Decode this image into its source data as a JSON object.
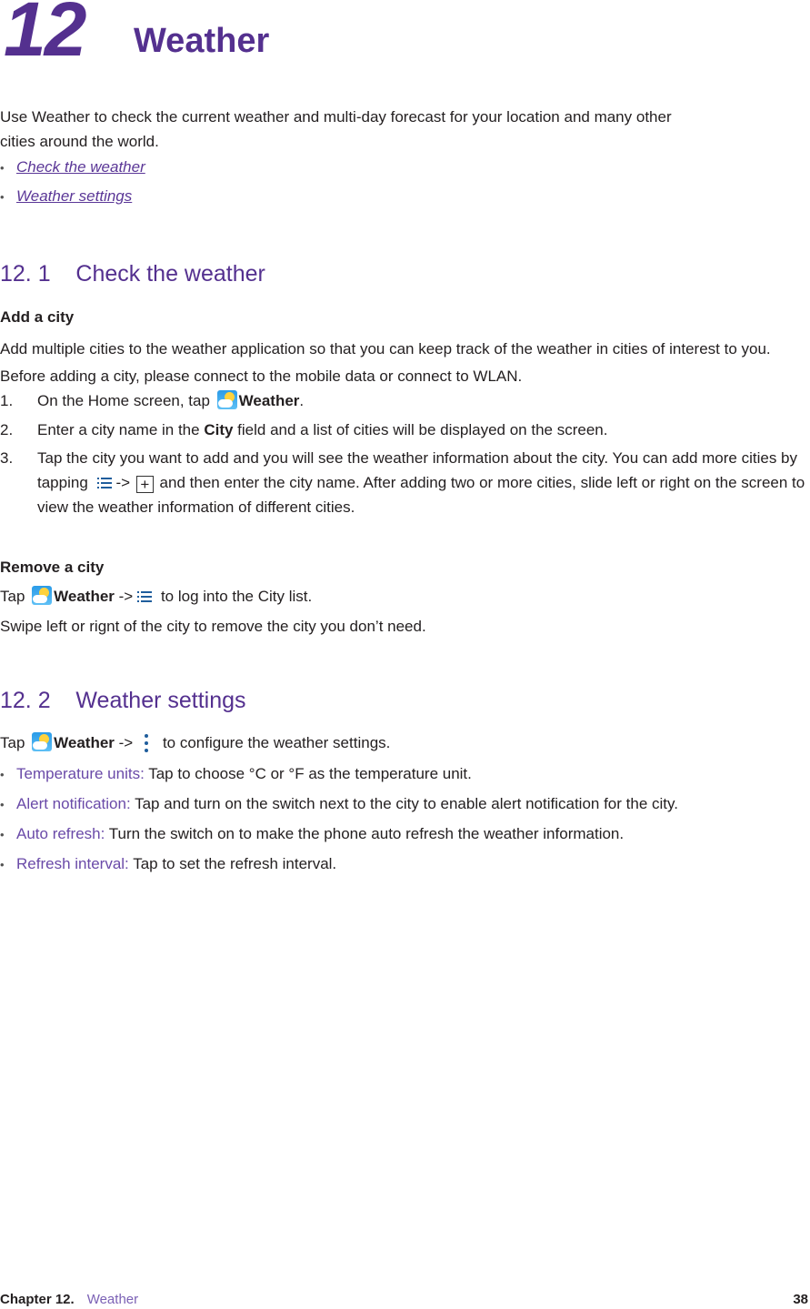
{
  "chapter": {
    "number": "12",
    "title": "Weather"
  },
  "intro": "Use Weather to check the current weather and multi-day forecast for your location and many other cities around the world.",
  "toc": [
    {
      "label": "Check the weather"
    },
    {
      "label": "Weather settings"
    }
  ],
  "section1": {
    "number": "12. 1",
    "title": "Check the weather",
    "add_city": {
      "heading": "Add a city",
      "description": "Add multiple cities to the weather application so that you can keep track of the weather in cities of interest to you. Before adding a city, please connect to the mobile data or connect to WLAN.",
      "steps": [
        {
          "num": "1.",
          "pre": "On the Home screen, tap ",
          "bold": "Weather",
          "post": "."
        },
        {
          "num": "2.",
          "pre": "Enter a city name in the ",
          "bold": "City",
          "post": " field and a list of cities will be displayed on the screen."
        },
        {
          "num": "3.",
          "pre": "Tap the city you want to add and you will see the weather information about the city. You can add more cities by tapping ",
          "arrow": "->",
          "post": " and then enter the city name. After adding two or more cities, slide left or right on the screen to view the weather information of different cities.",
          "plus": "+"
        }
      ]
    },
    "remove_city": {
      "heading": "Remove a city",
      "line1_pre": "Tap ",
      "line1_bold": "Weather",
      "line1_arrow": " ->",
      "line1_post": " to log into the City list.",
      "line2": "Swipe left or rignt of the city to remove the city you don’t need."
    }
  },
  "section2": {
    "number": "12. 2",
    "title": "Weather settings",
    "intro_pre": "Tap ",
    "intro_bold": "Weather",
    "intro_arrow": " ->",
    "intro_post": " to configure the weather settings.",
    "items": [
      {
        "term": "Temperature units:",
        "desc": " Tap to choose °C or °F as the temperature unit."
      },
      {
        "term": "Alert notification:",
        "desc": " Tap and turn on the switch next to the city to enable alert notification for the city."
      },
      {
        "term": "Auto refresh:",
        "desc": " Turn the switch on to make the phone auto refresh the weather information."
      },
      {
        "term": "Refresh interval:",
        "desc": " Tap to set the refresh interval."
      }
    ]
  },
  "footer": {
    "chapter": "Chapter 12.",
    "chapter_name": "Weather",
    "page": "38"
  },
  "icons": {
    "bullet": "•",
    "app": "weather-app-icon",
    "list": "list-icon",
    "more": "kebab-menu-icon"
  },
  "colors": {
    "accent": "#54308f",
    "term": "#6a4aa8",
    "icon_blue": "#1f5d9c",
    "text": "#231f20"
  }
}
